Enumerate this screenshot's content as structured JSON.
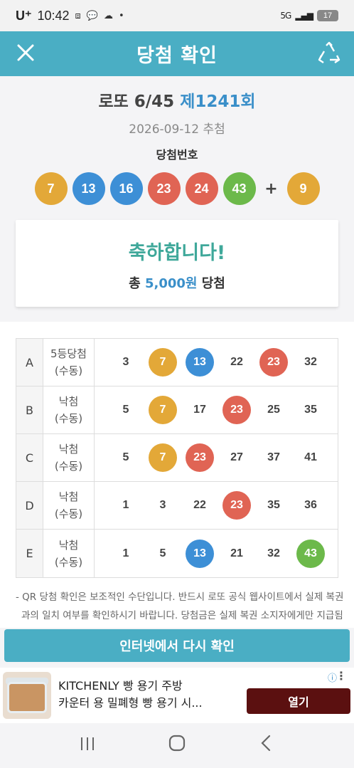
{
  "status_bar": {
    "carrier": "U⁺",
    "time": "10:42",
    "talk_badge": "TALK",
    "network": "5G",
    "battery": "17"
  },
  "header": {
    "title": "당첨 확인",
    "close_icon": "close-icon",
    "refresh_icon": "recycle-icon"
  },
  "summary": {
    "lottery_name": "로또 6/45",
    "round": "제1241회",
    "draw_date": "2026-09-12 추첨",
    "winning_label": "당첨번호",
    "winning_numbers": [
      "7",
      "13",
      "16",
      "23",
      "24",
      "43"
    ],
    "plus": "+",
    "bonus_number": "9",
    "congrats": "축하합니다!",
    "prize_prefix": "총",
    "prize_amount": "5,000원",
    "prize_suffix": "당첨"
  },
  "games": [
    {
      "letter": "A",
      "result": "5등당첨",
      "mode": "(수동)",
      "numbers": [
        "3",
        "7",
        "13",
        "22",
        "23",
        "32"
      ],
      "hits": [
        false,
        true,
        true,
        false,
        true,
        false
      ]
    },
    {
      "letter": "B",
      "result": "낙첨",
      "mode": "(수동)",
      "numbers": [
        "5",
        "7",
        "17",
        "23",
        "25",
        "35"
      ],
      "hits": [
        false,
        true,
        false,
        true,
        false,
        false
      ]
    },
    {
      "letter": "C",
      "result": "낙첨",
      "mode": "(수동)",
      "numbers": [
        "5",
        "7",
        "23",
        "27",
        "37",
        "41"
      ],
      "hits": [
        false,
        true,
        true,
        false,
        false,
        false
      ]
    },
    {
      "letter": "D",
      "result": "낙첨",
      "mode": "(수동)",
      "numbers": [
        "1",
        "3",
        "22",
        "23",
        "35",
        "36"
      ],
      "hits": [
        false,
        false,
        false,
        true,
        false,
        false
      ]
    },
    {
      "letter": "E",
      "result": "낙첨",
      "mode": "(수동)",
      "numbers": [
        "1",
        "5",
        "13",
        "21",
        "32",
        "43"
      ],
      "hits": [
        false,
        false,
        true,
        false,
        false,
        true
      ]
    }
  ],
  "notice": {
    "line1": "- QR 당첨 확인은 보조적인 수단입니다. 반드시 로또 공식 웹사이트에서 실제 복권",
    "line2": "과의 일치 여부를 확인하시기 바랍니다. 당첨금은 실제 복권 소지자에게만 지급됨"
  },
  "recheck_label": "인터넷에서 다시 확인",
  "ad": {
    "title_line1": "KITCHENLY 빵 용기 주방",
    "title_line2": "카운터 용 밀폐형 빵 용기 시...",
    "open_label": "열기",
    "info_icon": "info-icon",
    "menu_icon": "more-vertical-icon"
  },
  "nav": {
    "recent": "|||",
    "home": "○",
    "back": "<"
  },
  "ball_colors": {
    "yellow": "#e3a838",
    "blue": "#3d8fd6",
    "red": "#e06454",
    "green": "#6cb94a"
  }
}
